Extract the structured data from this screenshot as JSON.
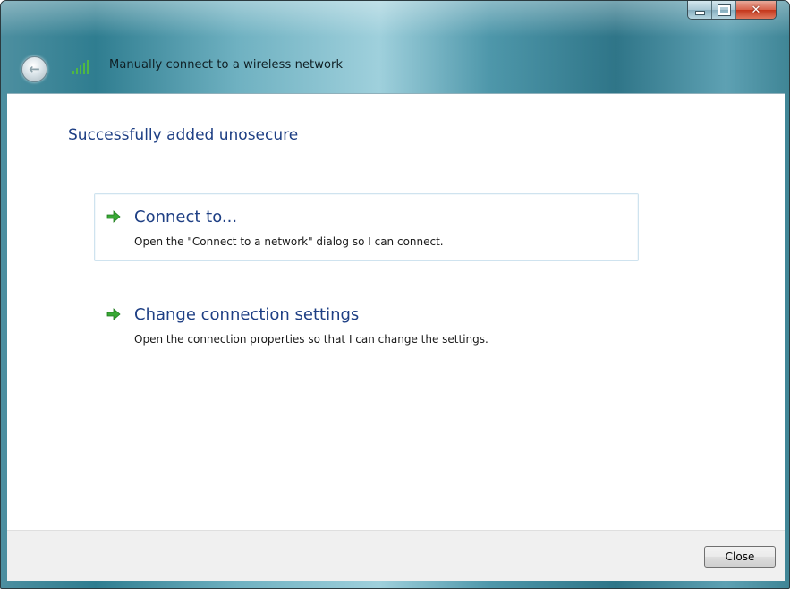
{
  "window": {
    "title": "Manually connect to a wireless network",
    "close_glyph": "✕"
  },
  "nav": {
    "back_glyph": "←"
  },
  "main": {
    "heading": "Successfully added unosecure",
    "options": [
      {
        "title": "Connect to...",
        "description": "Open the \"Connect to a network\" dialog so I can connect.",
        "icon": "green-arrow-icon"
      },
      {
        "title": "Change connection settings",
        "description": "Open the connection properties so that I can change the settings.",
        "icon": "green-arrow-icon"
      }
    ]
  },
  "footer": {
    "close_label": "Close"
  },
  "colors": {
    "heading": "#1e3f84",
    "arrow": "#39a935",
    "close_button_red": "#c3361b"
  }
}
